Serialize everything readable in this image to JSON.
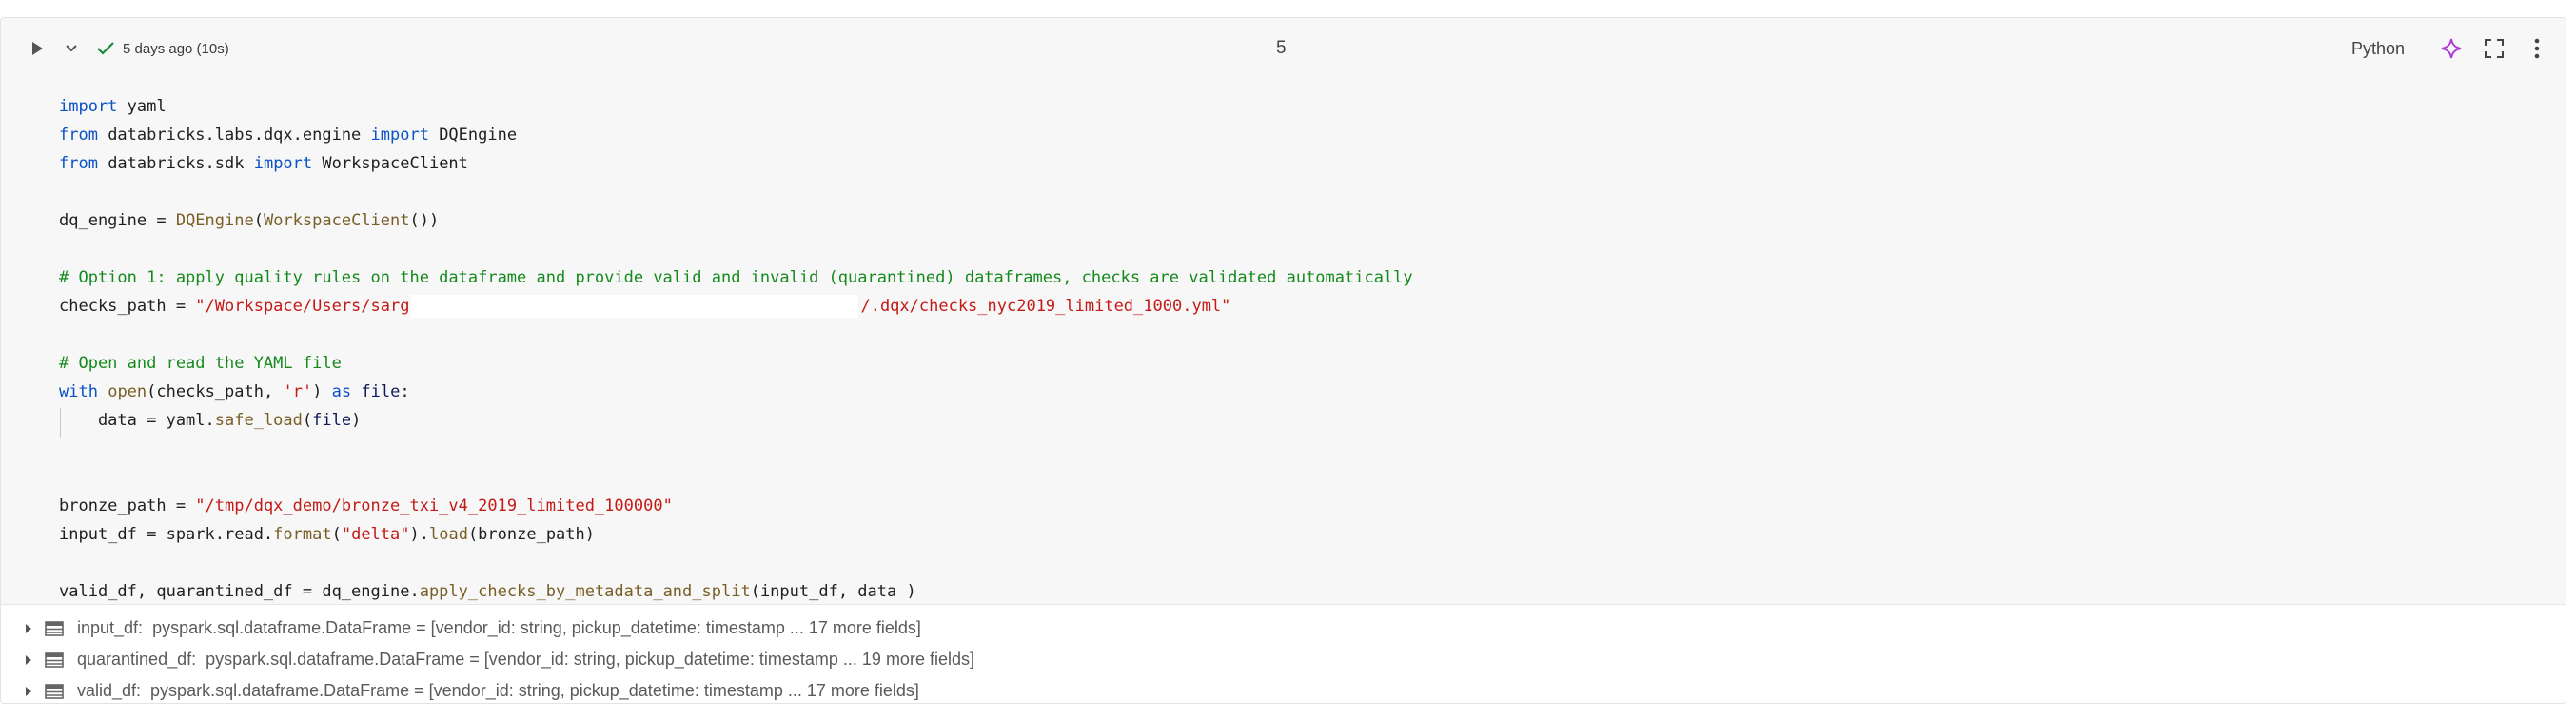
{
  "cell": {
    "status_text": "5 days ago (10s)",
    "number": "5",
    "language": "Python",
    "icons": [
      "play-icon",
      "chevron-down-icon",
      "check-icon",
      "assistant-sparkle-icon",
      "expand-icon",
      "more-vertical-icon"
    ]
  },
  "code": {
    "l1": {
      "a": "import",
      "b": " yaml"
    },
    "l2": {
      "a": "from",
      "b": " databricks.labs.dqx.engine ",
      "c": "import",
      "d": " DQEngine"
    },
    "l3": {
      "a": "from",
      "b": " databricks.sdk ",
      "c": "import",
      "d": " WorkspaceClient"
    },
    "l5": {
      "a": "dq_engine = ",
      "b": "DQEngine",
      "c": "(",
      "d": "WorkspaceClient",
      "e": "())"
    },
    "l7": {
      "a": "# Option 1: apply quality rules on the dataframe and provide valid and invalid (quarantined) dataframes, checks are validated automatically"
    },
    "l8": {
      "a": "checks_path = ",
      "b": "\"/Workspace/Users/sarg",
      "c": "/.dqx/checks_nyc2019_limited_1000.yml\""
    },
    "l10": {
      "a": "# Open and read the YAML file"
    },
    "l11": {
      "a": "with",
      "b": " ",
      "c": "open",
      "d": "(checks_path, ",
      "e": "'r'",
      "f": ") ",
      "g": "as",
      "h": " ",
      "i": "file",
      "j": ":"
    },
    "l12": {
      "a": "    data = yaml.",
      "b": "safe_load",
      "c": "(",
      "d": "file",
      "e": ")"
    },
    "l15": {
      "a": "bronze_path = ",
      "b": "\"/tmp/dqx_demo/bronze_txi_v4_2019_limited_100000\""
    },
    "l16": {
      "a": "input_df = spark.read.",
      "b": "format",
      "c": "(",
      "d": "\"delta\"",
      "e": ").",
      "f": "load",
      "g": "(bronze_path)"
    },
    "l18": {
      "a": "valid_df, quarantined_df = dq_engine.",
      "b": "apply_checks_by_metadata_and_split",
      "c": "(input_df, data )"
    }
  },
  "outputs": [
    {
      "name": "input_df:",
      "type": "pyspark.sql.dataframe.DataFrame = [vendor_id: string, pickup_datetime: timestamp ... 17 more fields]"
    },
    {
      "name": "quarantined_df:",
      "type": "pyspark.sql.dataframe.DataFrame = [vendor_id: string, pickup_datetime: timestamp ... 19 more fields]"
    },
    {
      "name": "valid_df:",
      "type": "pyspark.sql.dataframe.DataFrame = [vendor_id: string, pickup_datetime: timestamp ... 17 more fields]"
    }
  ],
  "colors": {
    "keyword": "#0b52c5",
    "function": "#795e26",
    "string": "#c41a16",
    "comment": "#148a1c",
    "assistant": "#b03ad8",
    "check": "#1f8a3b"
  }
}
